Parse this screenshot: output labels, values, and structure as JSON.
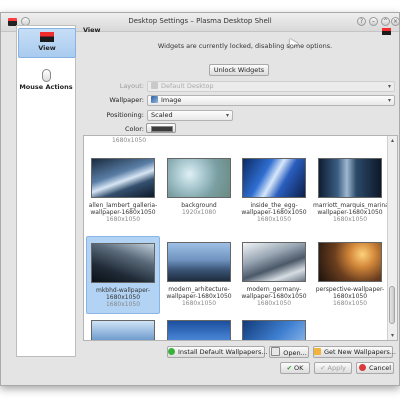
{
  "window": {
    "title": "Desktop Settings – Plasma Desktop Shell"
  },
  "sidebar": {
    "items": [
      {
        "label": "View",
        "icon": "flag-icon",
        "selected": true
      },
      {
        "label": "Mouse Actions",
        "icon": "mouse-icon",
        "selected": false
      }
    ]
  },
  "main": {
    "title": "View",
    "notice": "Widgets are currently locked, disabling some options.",
    "unlock_label": "Unlock Widgets"
  },
  "form": {
    "layout_label": "Layout:",
    "layout_value": "Default Desktop",
    "wallpaper_label": "Wallpaper:",
    "wallpaper_value": "Image",
    "positioning_label": "Positioning:",
    "positioning_value": "Scaled",
    "color_label": "Color:"
  },
  "gallery": {
    "top_cut_res": "1680x1050",
    "items": [
      {
        "name": "allen_lambert_galleria-wallpaper-1680x1050",
        "res": "1680x1050"
      },
      {
        "name": "background",
        "res": "1920x1080"
      },
      {
        "name": "inside_the_egg-wallpaper-1680x1050",
        "res": "1680x1050"
      },
      {
        "name": "marriott_marquis_marina_building-wallpaper-1680x1050",
        "res": "1680x1050"
      },
      {
        "name": "mkbhd-wallpaper-1680x1050",
        "res": "1680x1050"
      },
      {
        "name": "modern_arhitecture-wallpaper-1680x1050",
        "res": "1680x1050"
      },
      {
        "name": "modern_germany-wallpaper-1680x1050",
        "res": "1680x1050"
      },
      {
        "name": "perspective-wallpaper-1680x1050",
        "res": "1680x1050"
      }
    ],
    "selected_index": 4
  },
  "buttons": {
    "install": "Install Default Wallpapers...",
    "open": "Open...",
    "get_new": "Get New Wallpapers...",
    "ok": "OK",
    "apply": "Apply",
    "cancel": "Cancel"
  },
  "colors": {
    "selection": "#b2d3f4",
    "flag_red": "#f12d2d"
  }
}
